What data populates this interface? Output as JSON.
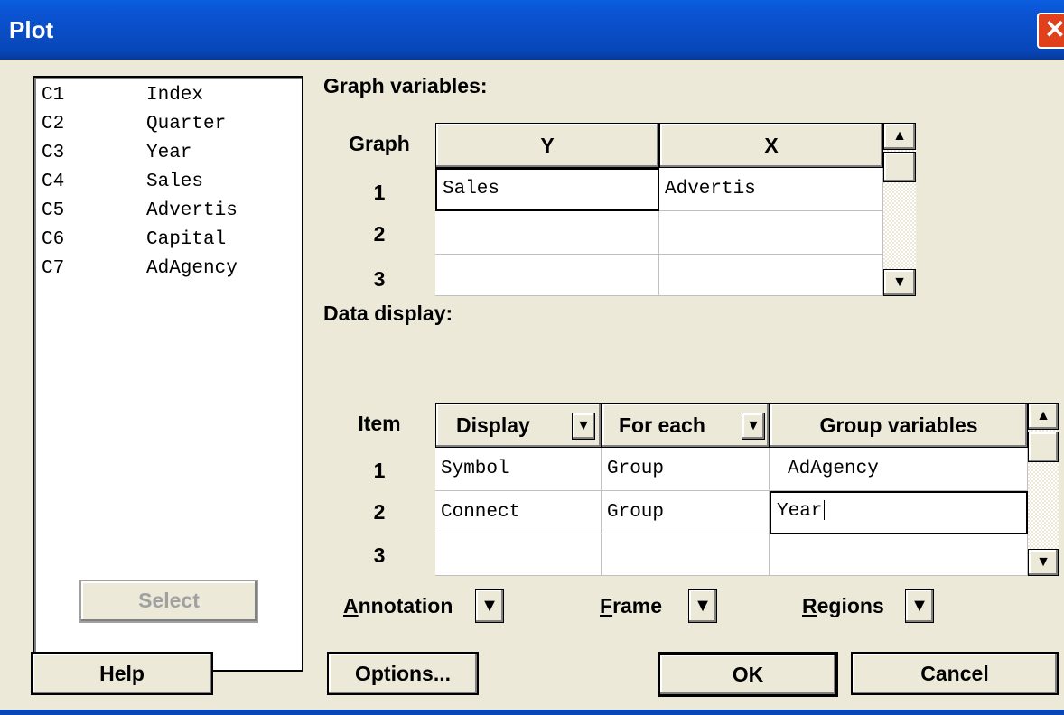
{
  "window": {
    "title": "Plot",
    "close": "✕"
  },
  "columns": [
    {
      "id": "C1",
      "name": "Index"
    },
    {
      "id": "C2",
      "name": "Quarter"
    },
    {
      "id": "C3",
      "name": "Year"
    },
    {
      "id": "C4",
      "name": "Sales"
    },
    {
      "id": "C5",
      "name": "Advertis"
    },
    {
      "id": "C6",
      "name": "Capital"
    },
    {
      "id": "C7",
      "name": "AdAgency"
    }
  ],
  "buttons": {
    "select": "Select",
    "help": "Help",
    "options": "Options...",
    "ok": "OK",
    "cancel": "Cancel"
  },
  "graph_variables": {
    "label": "Graph variables:",
    "row_header": "Graph",
    "col_y": "Y",
    "col_x": "X",
    "rows": [
      {
        "n": "1",
        "y": "Sales",
        "x": "Advertis"
      },
      {
        "n": "2",
        "y": "",
        "x": ""
      },
      {
        "n": "3",
        "y": "",
        "x": ""
      }
    ]
  },
  "data_display": {
    "label": "Data display:",
    "row_header": "Item",
    "col_display": "Display",
    "col_foreach": "For each",
    "col_groupvars": "Group variables",
    "rows": [
      {
        "n": "1",
        "display": "Symbol",
        "foreach": "Group",
        "groupvars": "AdAgency"
      },
      {
        "n": "2",
        "display": "Connect",
        "foreach": "Group",
        "groupvars": "Year"
      },
      {
        "n": "3",
        "display": "",
        "foreach": "",
        "groupvars": ""
      }
    ]
  },
  "menus": {
    "annotation_first": "A",
    "annotation_rest": "nnotation",
    "frame_first": "F",
    "frame_rest": "rame",
    "regions_first": "R",
    "regions_rest": "egions"
  },
  "icons": {
    "dropdown": "▼",
    "scroll_up": "▲",
    "scroll_down": "▼"
  }
}
